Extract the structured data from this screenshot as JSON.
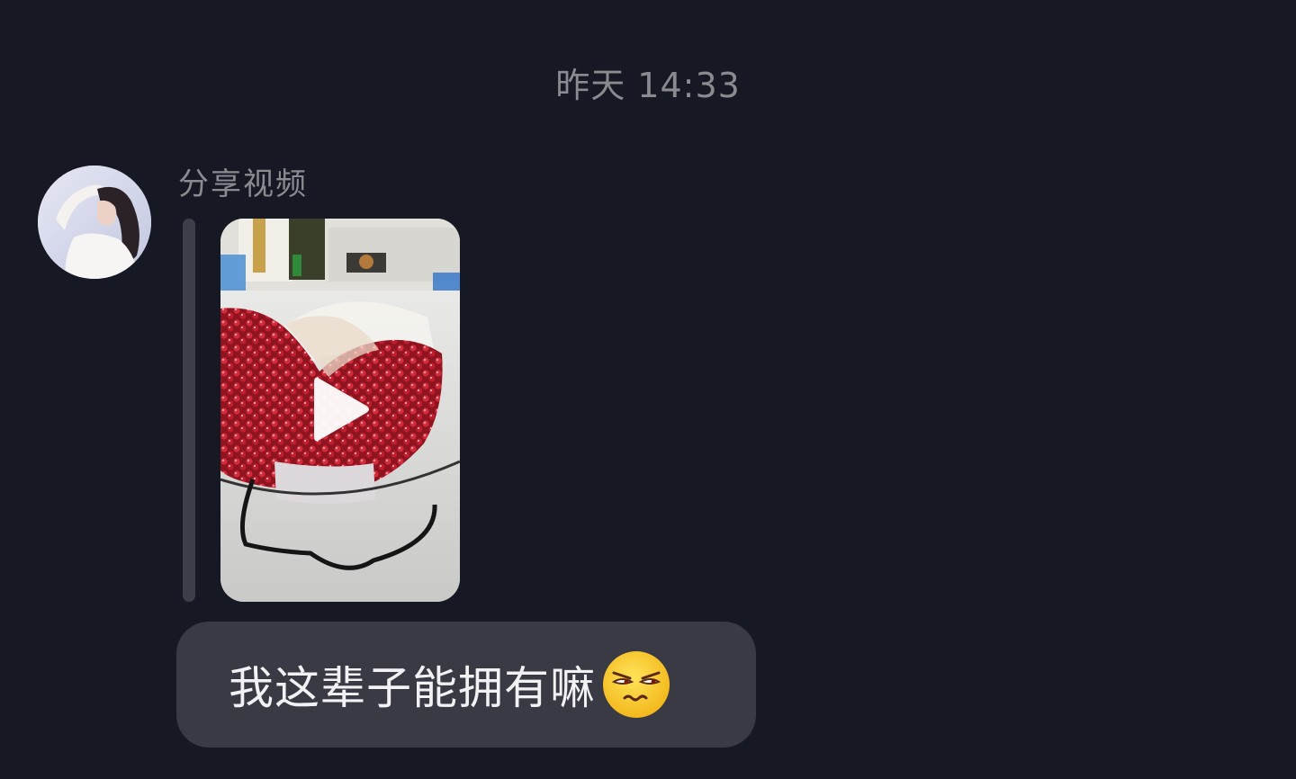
{
  "chat": {
    "timestamp": "昨天 14:33",
    "message_group": {
      "sender_avatar": "avatar-photo",
      "share_label": "分享视频",
      "shared_video": {
        "thumbnail": "pomegranate-seeds-bag",
        "play_icon": "play-icon"
      },
      "text_message": {
        "text": "我这辈子能拥有嘛",
        "trailing_emoji": "smirk-squint-emoji"
      }
    }
  },
  "colors": {
    "background": "#161823",
    "bubble": "#393a44",
    "muted_text": "#8a8b91",
    "message_text": "#f2f2f4"
  }
}
